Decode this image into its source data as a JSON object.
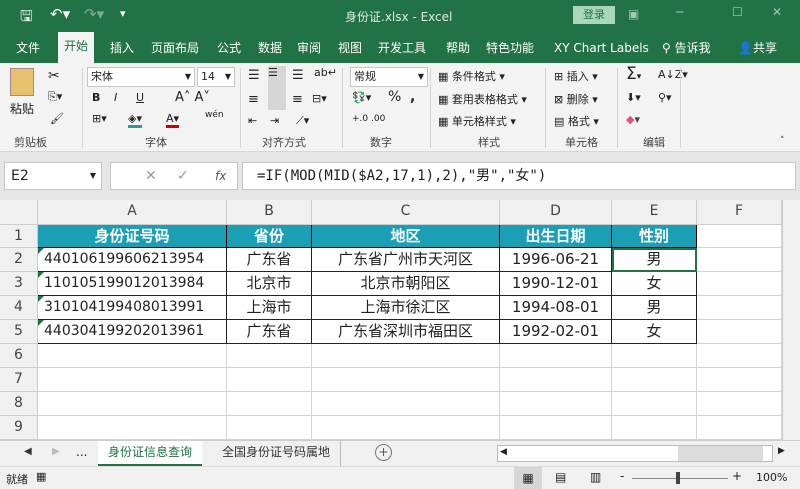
{
  "title": "身份证.xlsx  -  Excel",
  "login": "登录",
  "tabs": [
    "文件",
    "开始",
    "插入",
    "页面布局",
    "公式",
    "数据",
    "审阅",
    "视图",
    "开发工具",
    "帮助",
    "特色功能",
    "XY Chart Labels",
    "告诉我",
    "共享"
  ],
  "ribbon": {
    "paste": "粘贴",
    "font_name": "宋体",
    "font_size": "14",
    "number_format": "常规",
    "cond_format": "条件格式",
    "table_format": "套用表格格式",
    "cell_style": "单元格样式",
    "insert": "插入",
    "delete": "删除",
    "format": "格式",
    "bold": "B",
    "italic": "I",
    "underline": "U",
    "percent": "%",
    "comma": ",",
    "wen": "wén",
    "groups": [
      "剪贴板",
      "字体",
      "对齐方式",
      "数字",
      "样式",
      "单元格",
      "编辑"
    ]
  },
  "name_box": "E2",
  "formula": "=IF(MOD(MID($A2,17,1),2),\"男\",\"女\")",
  "columns": [
    "A",
    "B",
    "C",
    "D",
    "E",
    "F"
  ],
  "rows": [
    "1",
    "2",
    "3",
    "4",
    "5",
    "6",
    "7",
    "8",
    "9"
  ],
  "table": {
    "headers": [
      "身份证号码",
      "省份",
      "地区",
      "出生日期",
      "性别"
    ],
    "data": [
      [
        "440106199606213954",
        "广东省",
        "广东省广州市天河区",
        "1996-06-21",
        "男"
      ],
      [
        "110105199012013984",
        "北京市",
        "北京市朝阳区",
        "1990-12-01",
        "女"
      ],
      [
        "310104199408013991",
        "上海市",
        "上海市徐汇区",
        "1994-08-01",
        "男"
      ],
      [
        "440304199202013961",
        "广东省",
        "广东省深圳市福田区",
        "1992-02-01",
        "女"
      ]
    ]
  },
  "sheets": [
    "身份证信息查询",
    "全国身份证号码属地"
  ],
  "ellipsis": "...",
  "status": "就绪",
  "zoom": "100%"
}
